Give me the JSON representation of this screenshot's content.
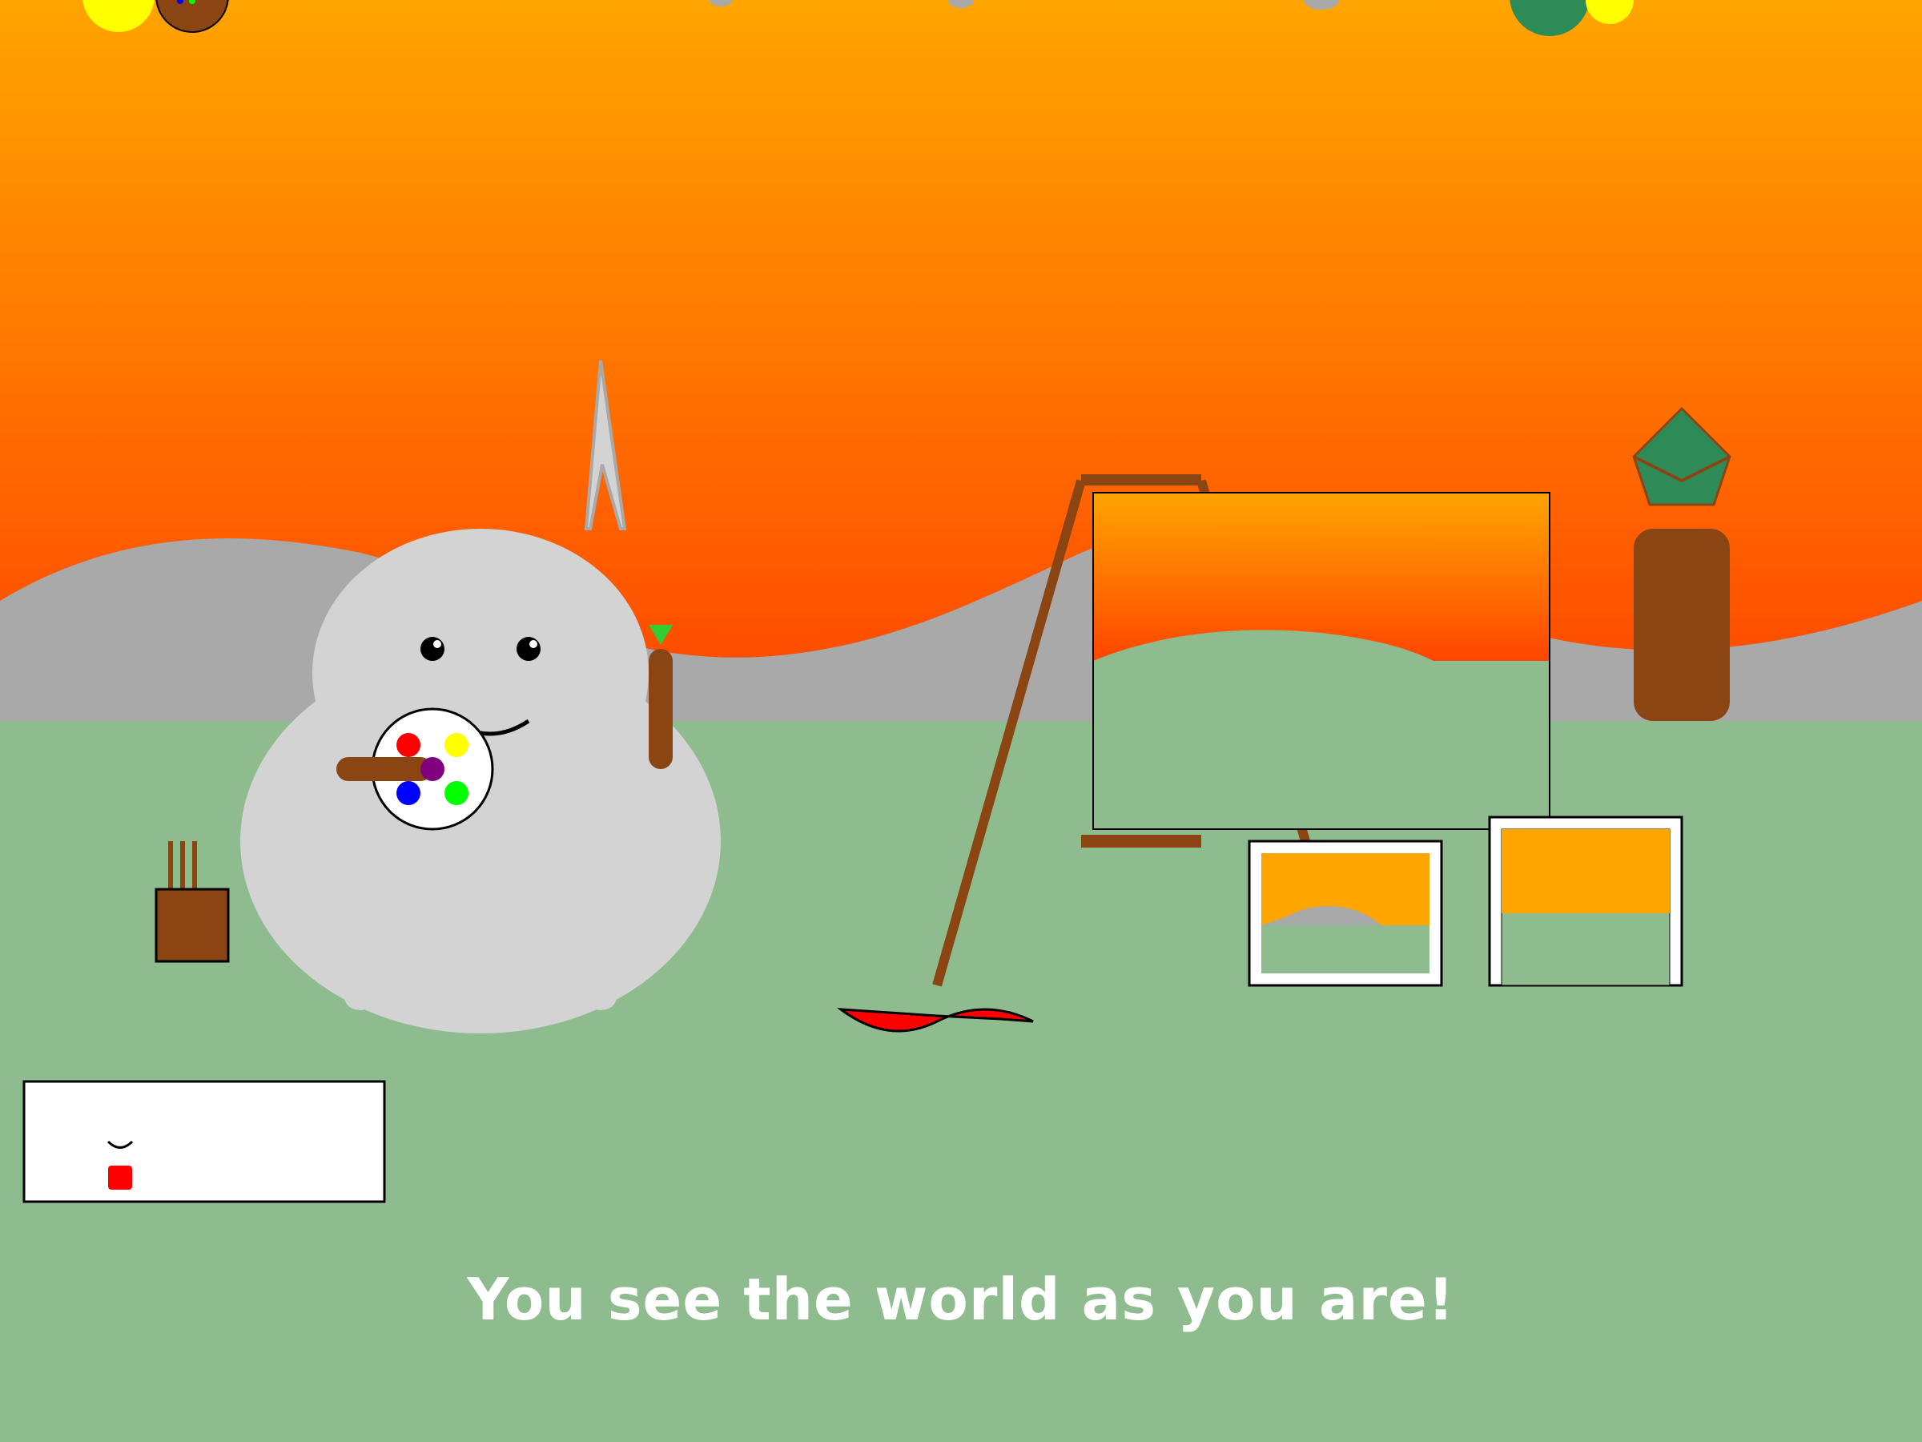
{
  "game": {
    "message": "You see the world as you are!"
  },
  "palette": {
    "sky_top": "#ffa500",
    "sky_bottom": "#ff4500",
    "hills": "#a9a9a9",
    "grass": "#8fbc8f",
    "snowman": "#d3d3d3",
    "wood": "#8b4513",
    "vase_green": "#2e8b57",
    "paint_red": "#ff0000",
    "paint_yellow": "#ffff00",
    "paint_blue": "#0000ff",
    "paint_green": "#00ff00",
    "paint_purple": "#800080",
    "carrot_leaf": "#32cd32",
    "white": "#ffffff"
  },
  "icons": {
    "player": "snowman-painter-icon",
    "palette": "paint-palette-icon",
    "brush": "paintbrush-icon",
    "easel": "easel-icon",
    "brush_cup": "brush-cup-icon",
    "vase": "vase-icon",
    "inventory": "inventory-panel"
  }
}
